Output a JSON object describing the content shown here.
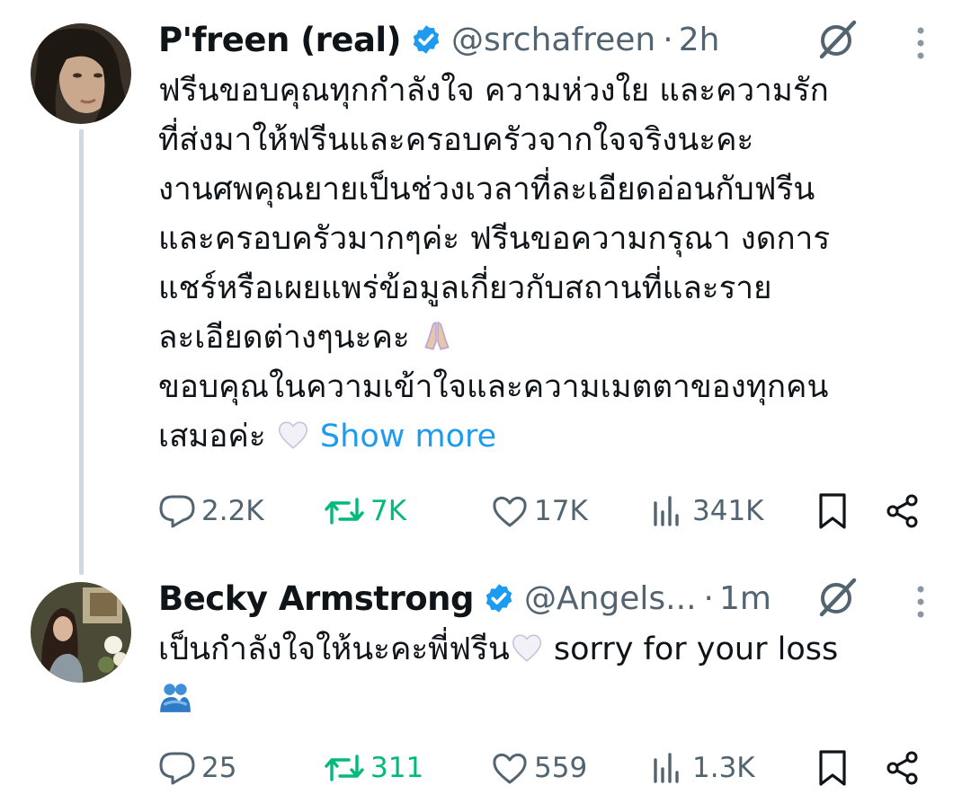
{
  "tweets": [
    {
      "name": "P'freen (real)",
      "handle": "@srchafreen",
      "separator": "·",
      "time": "2h",
      "lines": [
        "ฟรีนขอบคุณทุกกำลังใจ ความห่วงใย และความรัก",
        "ที่ส่งมาให้ฟรีนและครอบครัวจากใจจริงนะคะ",
        "งานศพคุณยายเป็นช่วงเวลาที่ละเอียดอ่อนกับฟรีน",
        "และครอบครัวมากๆค่ะ ฟรีนขอความกรุณา งดการ",
        "แชร์หรือเผยแพร่ข้อมูลเกี่ยวกับสถานที่และราย",
        "ละเอียดต่างๆนะคะ",
        "ขอบคุณในความเข้าใจและความเมตตาของทุกคน",
        "เสมอค่ะ"
      ],
      "show_more": "Show more",
      "stats": {
        "replies": "2.2K",
        "reposts": "7K",
        "likes": "17K",
        "views": "341K"
      }
    },
    {
      "name": "Becky Armstrong",
      "handle": "@Angels...",
      "separator": "·",
      "time": "1m",
      "lines": [
        "เป็นกำลังใจให้นะคะพี่ฟรีน",
        " sorry for your loss"
      ],
      "stats": {
        "replies": "25",
        "reposts": "311",
        "likes": "559",
        "views": "1.3K"
      }
    }
  ],
  "icons": {
    "verified": "verified-badge-icon",
    "grok": "grok-icon",
    "more": "more-options-icon",
    "reply": "reply-icon",
    "repost": "repost-icon",
    "like": "heart-icon",
    "views": "views-icon",
    "bookmark": "bookmark-icon",
    "share": "share-icon",
    "emoji_pray": "folded-hands-emoji",
    "emoji_heart": "white-heart-emoji",
    "emoji_hug": "people-hugging-emoji"
  },
  "colors": {
    "accent": "#1d9bf0",
    "repost": "#00ba7c",
    "muted": "#536471",
    "text": "#0f1419"
  }
}
